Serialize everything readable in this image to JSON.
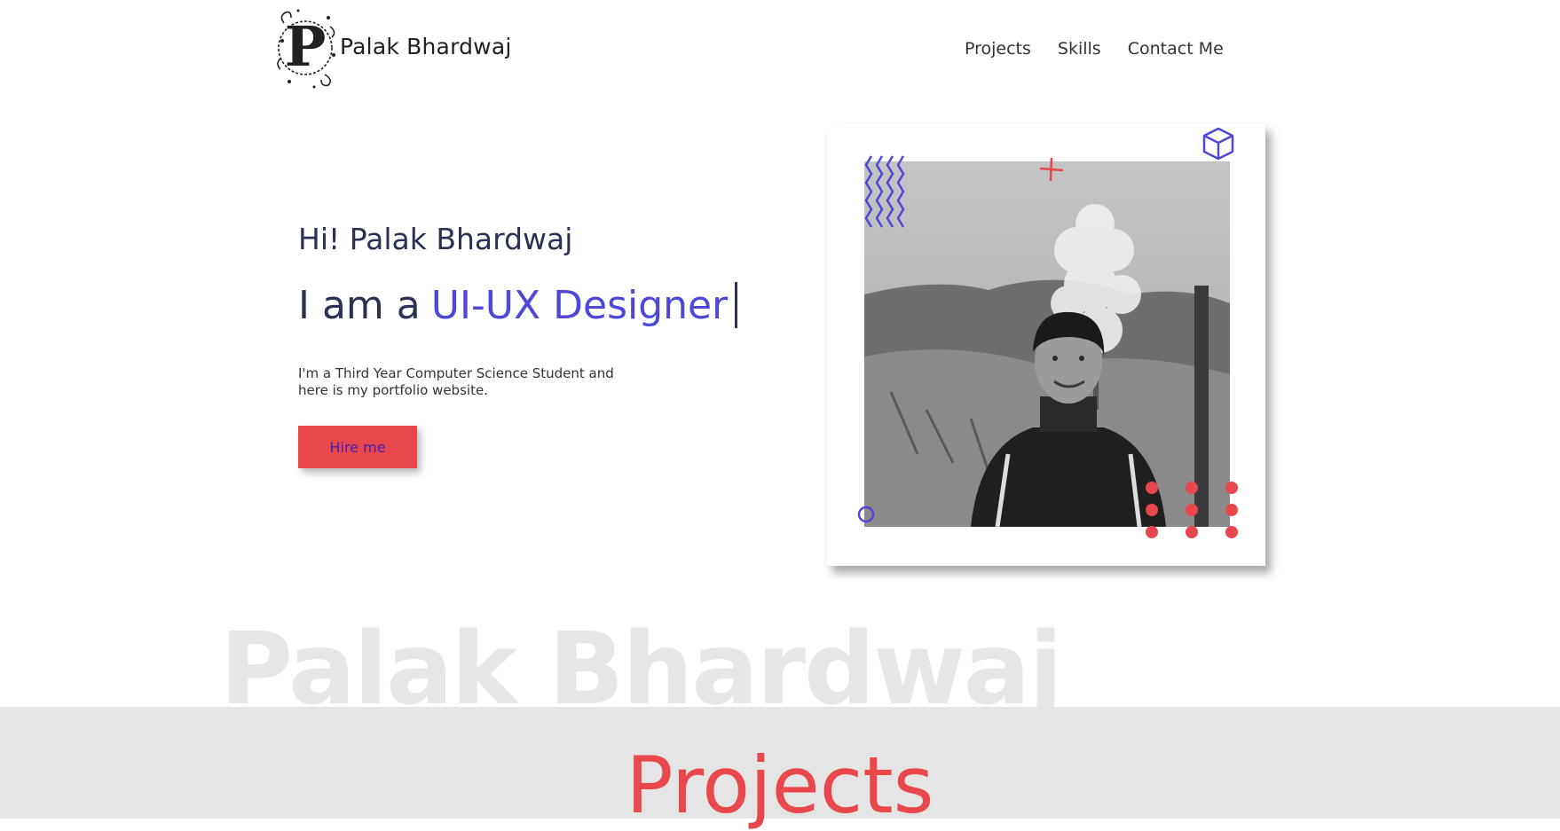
{
  "header": {
    "brand_name": "Palak Bhardwaj",
    "nav": [
      "Projects",
      "Skills",
      "Contact Me"
    ]
  },
  "hero": {
    "greeting": "Hi! Palak Bhardwaj",
    "role_prefix": "I am a",
    "role_accent": "UI-UX Designer",
    "description": "I'm a Third Year Computer Science Student and here is my portfolio website.",
    "cta_label": "Hire me"
  },
  "background_title": "Palak Bhardwaj",
  "section_title": "Projects",
  "colors": {
    "accent_purple": "#4f47d8",
    "accent_red": "#e8474b",
    "text_dark": "#2b3152",
    "band_grey": "#e5e5e5"
  },
  "icons": [
    "logo-letter-p",
    "zigzag-icon",
    "plus-icon",
    "cube-icon",
    "circle-icon",
    "dot-grid-icon"
  ]
}
